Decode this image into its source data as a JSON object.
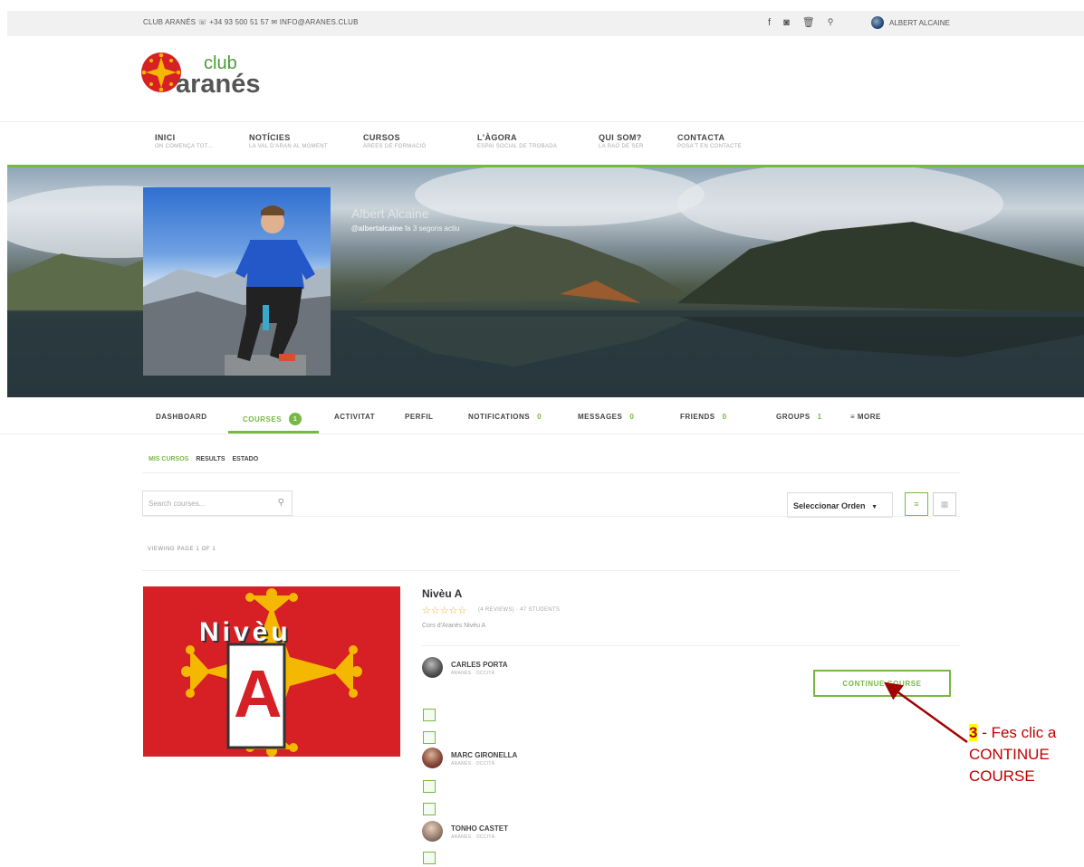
{
  "topbar": {
    "contact": "CLUB ARANÉS ☏ +34 93 500 51 57 ✉ INFO@ARANES.CLUB",
    "user_name": "ALBERT ALCAINE"
  },
  "logo": {
    "line1": "club",
    "line2": "aranés"
  },
  "nav": [
    {
      "title": "INICI",
      "sub": "ON COMENÇA TOT..."
    },
    {
      "title": "NOTÍCIES",
      "sub": "LA VAL D'ARAN AL MOMENT"
    },
    {
      "title": "CURSOS",
      "sub": "ÀREES DE FORMACIÓ"
    },
    {
      "title": "L'ÀGORA",
      "sub": "ESPAI SOCIAL DE TROBADA"
    },
    {
      "title": "QUI SOM?",
      "sub": "LA RAÓ DE SER"
    },
    {
      "title": "CONTACTA",
      "sub": "POSA'T EN CONTACTE"
    }
  ],
  "profile": {
    "name": "Albert Alcaine",
    "handle": "@albertalcaine",
    "active_time": "fa 3 segons actiu"
  },
  "profile_tabs": [
    {
      "label": "DASHBOARD",
      "count": ""
    },
    {
      "label": "COURSES",
      "count": "1"
    },
    {
      "label": "ACTIVITAT",
      "count": ""
    },
    {
      "label": "PERFIL",
      "count": ""
    },
    {
      "label": "NOTIFICATIONS",
      "count": "0"
    },
    {
      "label": "MESSAGES",
      "count": "0"
    },
    {
      "label": "FRIENDS",
      "count": "0"
    },
    {
      "label": "GROUPS",
      "count": "1"
    },
    {
      "label": "≡ MORE",
      "count": ""
    }
  ],
  "subtabs": [
    "MIS CURSOS",
    "RESULTS",
    "ESTADO"
  ],
  "search": {
    "placeholder": "Search courses..."
  },
  "order_select": "Seleccionar Orden",
  "viewing": "VIEWING PAGE 1 OF 1",
  "course": {
    "title": "Nivèu A",
    "stars": "☆☆☆☆☆",
    "reviews": "(4 REVIEWS) · 47 STUDENTS",
    "description": "Cors d'Aranés Nivèu A",
    "thumb_word": "Nivèu",
    "thumb_letter": "A",
    "instructors": [
      {
        "name": "CARLES PORTA",
        "loc": "ARANÉS · OCCITÀ"
      },
      {
        "name": "MARC GIRONELLA",
        "loc": "ARANÉS · OCCITÀ"
      },
      {
        "name": "TONHO CASTET",
        "loc": "ARANÉS · OCCITÀ"
      }
    ],
    "continue_label": "CONTINUE COURSE"
  },
  "annotation": {
    "number": "3",
    "text": " - Fes clic a CONTINUE COURSE"
  },
  "colors": {
    "accent": "#76b942",
    "annotation": "#c00000",
    "thumb_red": "#d71f26"
  }
}
